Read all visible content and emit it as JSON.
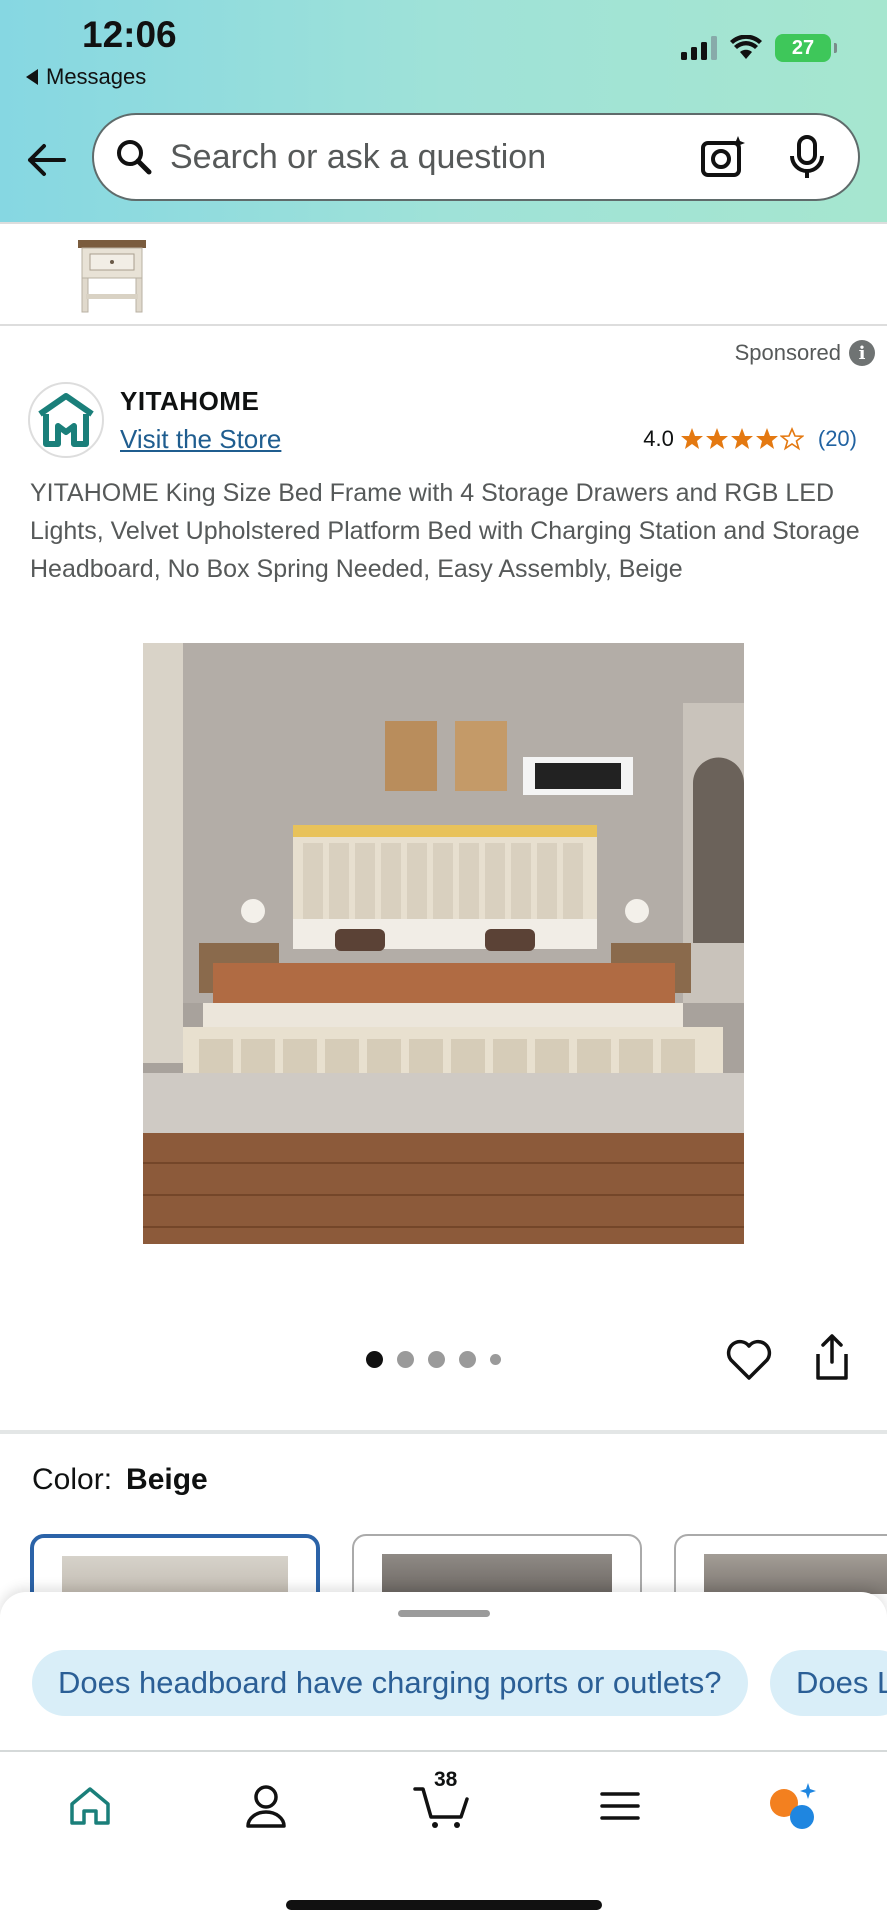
{
  "status_bar": {
    "time": "12:06",
    "back_app": "Messages",
    "battery": "27"
  },
  "header": {
    "search_placeholder": "Search or ask a question",
    "icons": [
      "back-arrow-icon",
      "search-icon",
      "camera-icon",
      "mic-icon"
    ]
  },
  "sponsored": {
    "label": "Sponsored"
  },
  "brand": {
    "name": "YITAHOME",
    "store_link": "Visit the Store",
    "rating": "4.0",
    "rating_value": 4.0,
    "review_count": "(20)"
  },
  "product": {
    "title": "YITAHOME King Size Bed Frame with 4 Storage Drawers and RGB LED Lights, Velvet Upholstered Platform Bed with Charging Station and Storage Headboard, No Box Spring Needed, Easy Assembly, Beige",
    "image_count": 5,
    "active_image": 1
  },
  "color": {
    "label": "Color:",
    "value": "Beige"
  },
  "questions": {
    "chips": [
      "Does headboard have charging ports or outlets?",
      "Does L"
    ]
  },
  "tabbar": {
    "cart_count": "38",
    "tabs": [
      "home-icon",
      "account-icon",
      "cart-icon",
      "menu-icon",
      "rufus-icon"
    ]
  },
  "colors": {
    "accent_link": "#1f5d8f",
    "star": "#e47911",
    "selected_border": "#2b63a8",
    "chip_bg": "#d9eef8",
    "header_gradient_start": "#86d7e2",
    "header_gradient_end": "#a6e6cf"
  }
}
